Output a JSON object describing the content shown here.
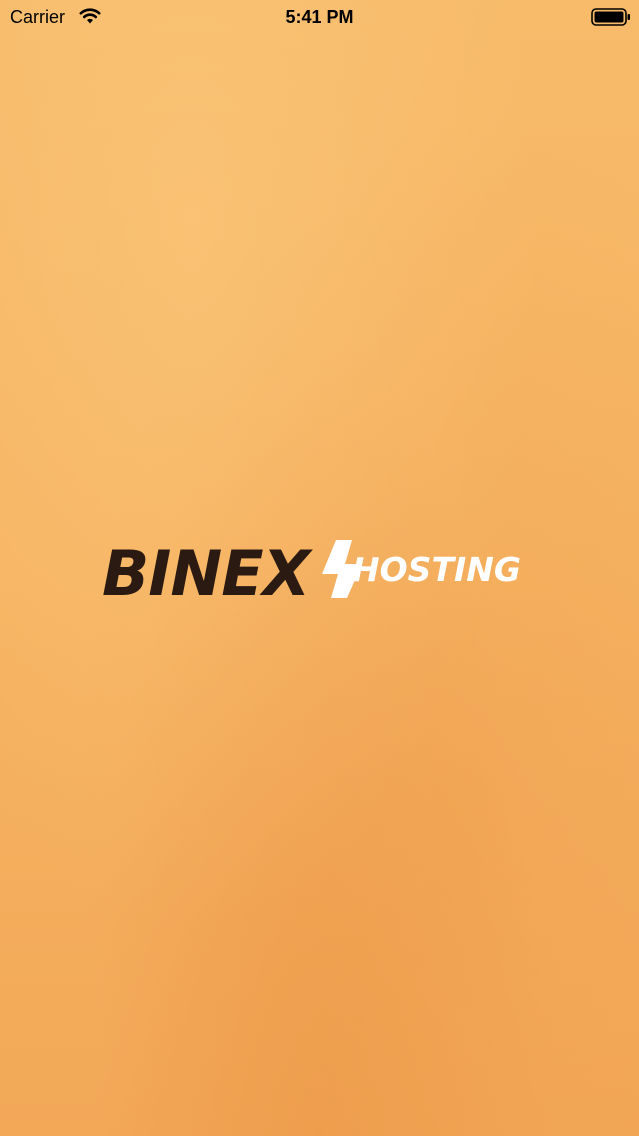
{
  "status_bar": {
    "carrier": "Carrier",
    "time": "5:41 PM",
    "icons": [
      "wifi-icon",
      "battery-icon"
    ]
  },
  "splash": {
    "logo_text_primary": "BINEX",
    "logo_text_secondary": "HOSTING",
    "colors": {
      "background": "#f6b664",
      "logo_dark": "#2a1a12",
      "logo_light": "#ffffff"
    }
  }
}
